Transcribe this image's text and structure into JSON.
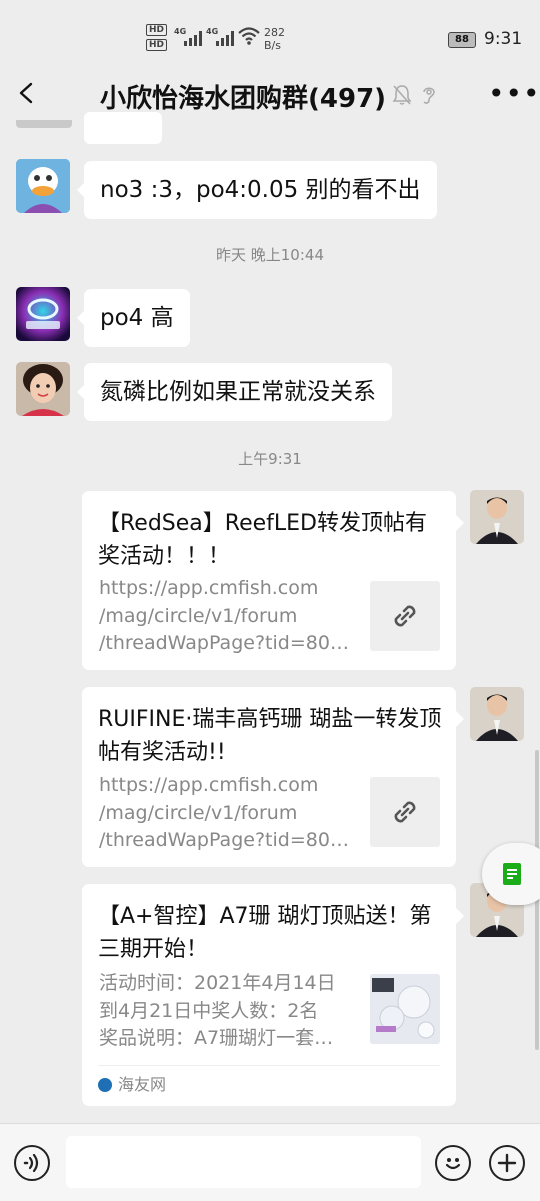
{
  "status_bar": {
    "speed_value": "282",
    "speed_unit": "B/s",
    "battery": "88",
    "time": "9:31",
    "network_badges": [
      "HD",
      "HD"
    ],
    "network_gen": [
      "4G",
      "4G"
    ]
  },
  "header": {
    "title": "小欣怡海水团购群(497)",
    "icons": [
      "back-arrow-icon",
      "mute-bell-icon",
      "earpiece-icon",
      "more-icon"
    ]
  },
  "messages": [
    {
      "sender": "duck-avatar",
      "text": "no3 :3，po4:0.05 别的看不出"
    },
    {
      "time": "昨天 晚上10:44"
    },
    {
      "sender": "aquarium-logo-avatar",
      "text": "po4 高"
    },
    {
      "sender": "child-avatar",
      "text": "氮磷比例如果正常就没关系"
    },
    {
      "time": "上午9:31"
    }
  ],
  "cards": [
    {
      "title": "【RedSea】ReefLED转发顶帖有奖活动！！！",
      "url_lines": [
        "https://app.cmfish.com",
        "/mag/circle/v1/forum",
        "/threadWapPage?tid=800…"
      ],
      "thumb": "link-icon"
    },
    {
      "title": "RUIFINE·瑞丰高钙珊 瑚盐一转发顶帖有奖活动!!",
      "url_lines": [
        "https://app.cmfish.com",
        "/mag/circle/v1/forum",
        "/threadWapPage?tid=803…"
      ],
      "thumb": "link-icon"
    },
    {
      "title": "【A+智控】A7珊 瑚灯顶贴送！第三期开始！",
      "url_lines": [
        "活动时间：2021年4月14日",
        "到4月21日中奖人数：2名",
        "奖品说明：A7珊瑚灯一套…"
      ],
      "thumb": "product-image",
      "source": "海友网"
    }
  ],
  "bottom_bar": {
    "input_placeholder": "",
    "icons": [
      "voice-icon",
      "emoji-icon",
      "plus-icon"
    ]
  }
}
